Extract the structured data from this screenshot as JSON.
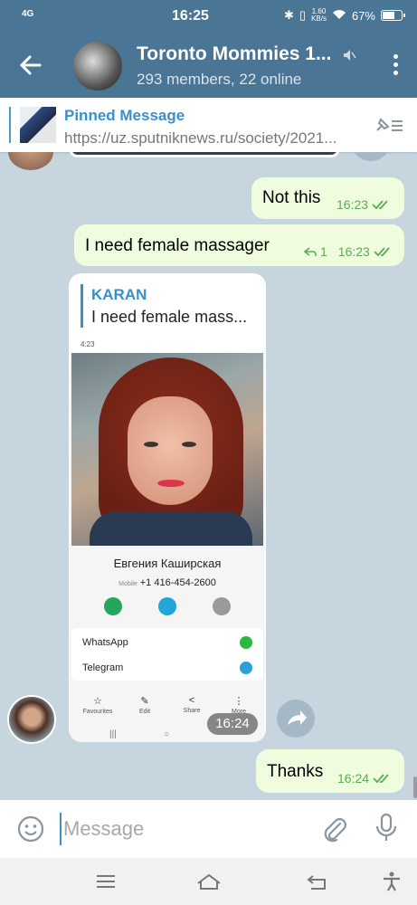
{
  "status_bar": {
    "signal": "4G",
    "time": "16:25",
    "net_speed": "1.60",
    "net_unit": "KB/s",
    "battery_percent": "67%",
    "battery_level": 0.67
  },
  "header": {
    "title": "Toronto Mommies 1...",
    "subtitle": "293 members, 22 online",
    "icons": [
      "back-arrow-icon",
      "mute-icon",
      "more-vert-icon"
    ]
  },
  "pinned": {
    "title": "Pinned Message",
    "text": "https://uz.sputniknews.ru/society/2021..."
  },
  "messages": [
    {
      "text": "Not this",
      "time": "16:23",
      "status": "read"
    },
    {
      "text": "I need female massager",
      "replies": "1",
      "time": "16:23",
      "status": "read"
    }
  ],
  "incoming": {
    "reply_to_name": "KARAN",
    "reply_to_text": "I need female mass...",
    "time": "16:24",
    "screenshot": {
      "status_time": "4:23",
      "contact_name": "Евгения Каширская",
      "phone_label": "Mobile",
      "phone": "+1 416-454-2600",
      "apps": [
        "WhatsApp",
        "Telegram"
      ],
      "nav": [
        "Favourites",
        "Edit",
        "Share",
        "More"
      ]
    }
  },
  "last_message": {
    "text": "Thanks",
    "time": "16:24",
    "status": "read"
  },
  "input": {
    "placeholder": "Message"
  },
  "colors": {
    "header": "#4a7595",
    "accent": "#3a8fcb",
    "outgoing_bubble": "#effdde",
    "read_ticks": "#5cab55"
  }
}
